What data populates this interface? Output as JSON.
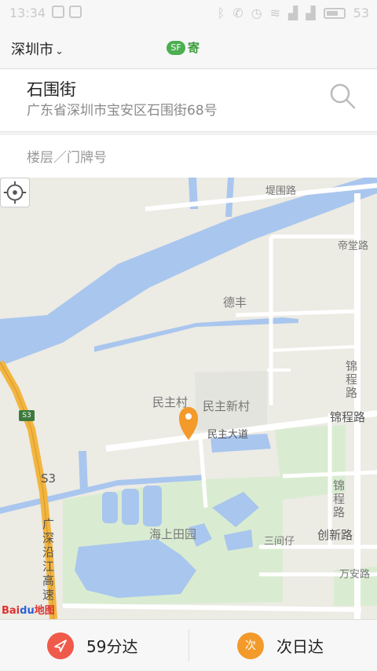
{
  "status_bar": {
    "time": "13:34",
    "battery": "53",
    "icons": [
      "bluetooth-icon",
      "phone-icon",
      "alarm-icon",
      "wifi-icon",
      "signal-icon",
      "battery-icon"
    ]
  },
  "header": {
    "city": "深圳市",
    "chevron": "⌄",
    "logo_mark": "SF",
    "logo_text": "寄"
  },
  "address": {
    "title": "石围街",
    "detail": "广东省深圳市宝安区石围街68号"
  },
  "floor_field": {
    "placeholder": "楼层／门牌号"
  },
  "map": {
    "labels": {
      "ditwei": "堤围路",
      "ditang": "帝堂路",
      "defeng": "德丰",
      "jincheng1": "锦程路",
      "minzhucun": "民主村",
      "minzhuxincun": "民主新村",
      "minzhudadao": "民主大道",
      "jinchenglu": "锦程路",
      "jincheng2": "锦程路",
      "haishang": "海上田园",
      "sanjianzai": "三间仔",
      "chuangxin": "创新路",
      "wanan": "万安路",
      "s3": "S3",
      "s3road": "S3",
      "highway": "广深沿江高速"
    },
    "logo_bai": "Bai",
    "logo_du": "du",
    "logo_ditu": "地图",
    "colors": {
      "water": "#a9c6ee",
      "land": "#ecebe4",
      "park": "#d9ecd1",
      "highway": "#f2b53f",
      "pin": "#f39a2b"
    }
  },
  "bottom": {
    "option1_label": "59分达",
    "option2_icon_text": "次",
    "option2_label": "次日达"
  }
}
